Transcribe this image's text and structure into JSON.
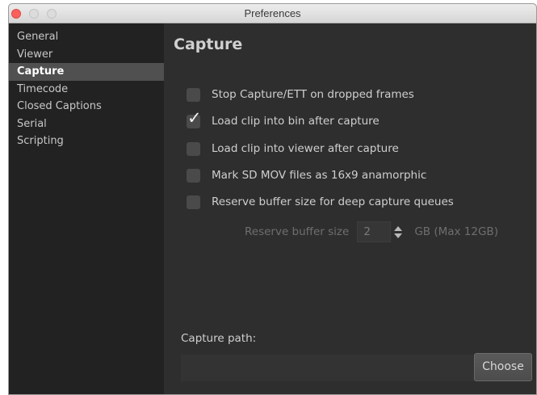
{
  "window": {
    "title": "Preferences"
  },
  "sidebar": {
    "items": [
      {
        "label": "General"
      },
      {
        "label": "Viewer"
      },
      {
        "label": "Capture"
      },
      {
        "label": "Timecode"
      },
      {
        "label": "Closed Captions"
      },
      {
        "label": "Serial"
      },
      {
        "label": "Scripting"
      }
    ],
    "selected": "Capture"
  },
  "main": {
    "title": "Capture",
    "options": [
      {
        "label": "Stop Capture/ETT on dropped frames",
        "checked": false
      },
      {
        "label": "Load clip into bin after capture",
        "checked": true
      },
      {
        "label": "Load clip into viewer after capture",
        "checked": false
      },
      {
        "label": "Mark SD MOV files as 16x9 anamorphic",
        "checked": false
      },
      {
        "label": "Reserve buffer size for deep capture queues",
        "checked": false
      }
    ],
    "checkmark_glyph": "✓",
    "buffer": {
      "label": "Reserve buffer size",
      "value": "2",
      "unit": "GB (Max 12GB)",
      "enabled": false
    },
    "capture_path": {
      "label": "Capture path:",
      "value": "",
      "button_label": "Choose"
    }
  },
  "colors": {
    "panel_bg": "#2e2e2e",
    "sidebar_bg": "#222222",
    "selected_bg": "#505050",
    "close_button": "#fc605c"
  }
}
